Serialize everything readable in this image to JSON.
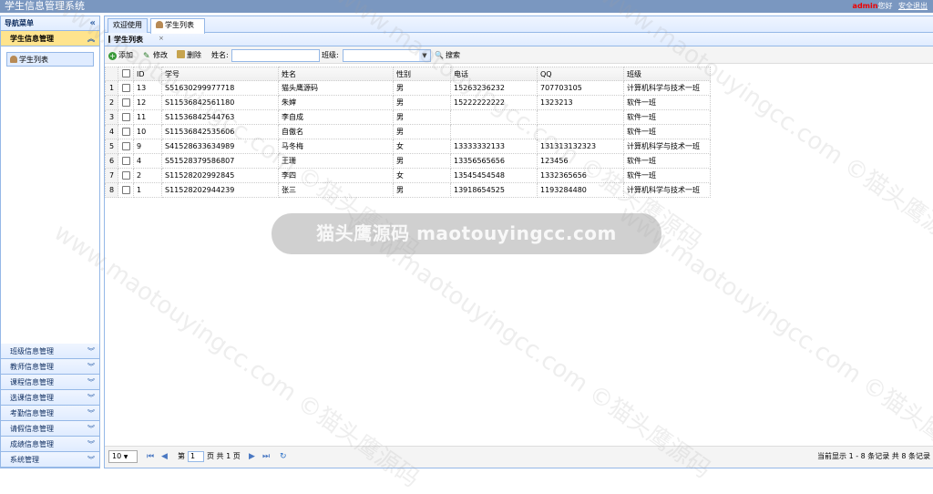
{
  "app_title": "学生信息管理系统",
  "topbar": {
    "user": "admin",
    "greeting": "您好",
    "logout": "安全退出"
  },
  "sidebar": {
    "header": "导航菜单",
    "active_section": "学生信息管理",
    "active_item": "学生列表",
    "sections": [
      "班级信息管理",
      "教师信息管理",
      "课程信息管理",
      "选课信息管理",
      "考勤信息管理",
      "请假信息管理",
      "成绩信息管理",
      "系统管理"
    ]
  },
  "tabs": {
    "welcome": "欢迎使用",
    "students": "学生列表",
    "close": "×"
  },
  "panel_title": "学生列表",
  "toolbar": {
    "add": "添加",
    "edit": "修改",
    "delete": "删除",
    "name_label": "姓名:",
    "class_label": "班级:",
    "search": "搜索"
  },
  "table": {
    "columns": [
      "ID",
      "学号",
      "姓名",
      "性别",
      "电话",
      "QQ",
      "班级"
    ],
    "rows": [
      {
        "n": "1",
        "id": "13",
        "sno": "S51630299977718",
        "name": "猫头鹰源码",
        "sex": "男",
        "phone": "15263236232",
        "qq": "707703105",
        "cls": "计算机科学与技术一班"
      },
      {
        "n": "2",
        "id": "12",
        "sno": "S11536842561180",
        "name": "朱婶",
        "sex": "男",
        "phone": "15222222222",
        "qq": "1323213",
        "cls": "软件一班"
      },
      {
        "n": "3",
        "id": "11",
        "sno": "S11536842544763",
        "name": "李自成",
        "sex": "男",
        "phone": "",
        "qq": "",
        "cls": "软件一班"
      },
      {
        "n": "4",
        "id": "10",
        "sno": "S11536842535606",
        "name": "自傲名",
        "sex": "男",
        "phone": "",
        "qq": "",
        "cls": "软件一班"
      },
      {
        "n": "5",
        "id": "9",
        "sno": "S41528633634989",
        "name": "马冬梅",
        "sex": "女",
        "phone": "13333332133",
        "qq": "131313132323",
        "cls": "计算机科学与技术一班"
      },
      {
        "n": "6",
        "id": "4",
        "sno": "S51528379586807",
        "name": "王珊",
        "sex": "男",
        "phone": "13356565656",
        "qq": "123456",
        "cls": "软件一班"
      },
      {
        "n": "7",
        "id": "2",
        "sno": "S11528202992845",
        "name": "李四",
        "sex": "女",
        "phone": "13545454548",
        "qq": "1332365656",
        "cls": "软件一班"
      },
      {
        "n": "8",
        "id": "1",
        "sno": "S11528202944239",
        "name": "张三",
        "sex": "男",
        "phone": "13918654525",
        "qq": "1193284480",
        "cls": "计算机科学与技术一班"
      }
    ]
  },
  "pager": {
    "page_size": "10",
    "page_prefix": "第",
    "page_value": "1",
    "page_suffix": "页 共 1 页",
    "info": "当前显示 1 - 8 条记录 共 8 条记录"
  },
  "watermark": {
    "band": "猫头鹰源码 maotouyingcc.com",
    "diag": "www.maotouyingcc.com ©猫头鹰源码"
  }
}
